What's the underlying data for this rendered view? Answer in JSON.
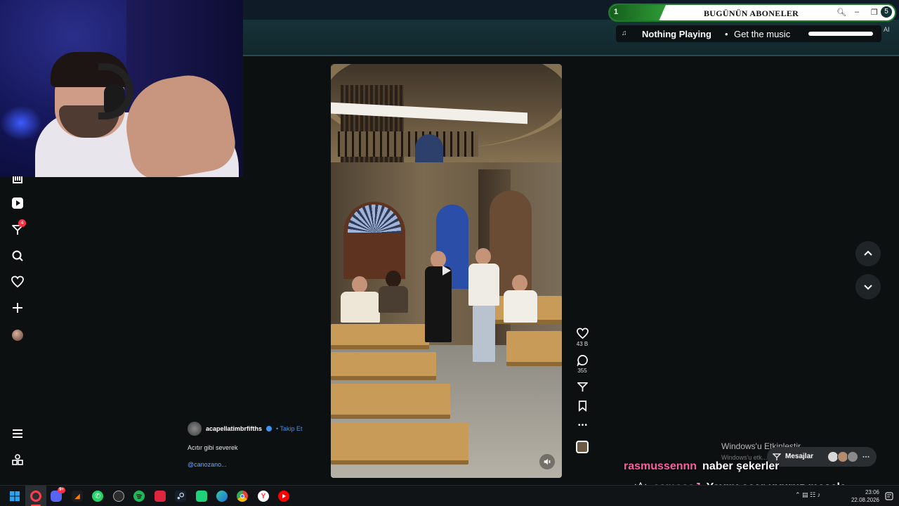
{
  "subscriber_bar": {
    "count": "1",
    "title": "BUGÜNÜN ABONELER",
    "corner_number": "5",
    "icons": [
      "search-icon",
      "minimize-icon",
      "restore-icon"
    ]
  },
  "now_playing": {
    "icon": "music-note-icon",
    "title": "Nothing Playing",
    "separator": "•",
    "subtitle": "Get the music",
    "ai_label": "AI"
  },
  "sidebar": {
    "items": [
      {
        "name": "threads-icon"
      },
      {
        "name": "reels-icon"
      },
      {
        "name": "messages-icon",
        "badge": "4"
      },
      {
        "name": "search-icon"
      },
      {
        "name": "notifications-icon"
      },
      {
        "name": "create-icon"
      },
      {
        "name": "profile-avatar"
      }
    ],
    "bottom": [
      {
        "name": "menu-icon"
      },
      {
        "name": "also-from-meta-icon"
      }
    ]
  },
  "post": {
    "username": "acapellatimbrfifths",
    "follow_label": "Takip Et",
    "caption": "Acıtır gibi severek",
    "mention": "@canozano...",
    "likes": "43 B",
    "comments": "355"
  },
  "windows_activation": {
    "title": "Windows'u Etkinleştir",
    "subtitle": "Windows'u etk..."
  },
  "messages_popup": {
    "label": "Mesajlar"
  },
  "chat": [
    {
      "user": "rasmussennn",
      "message": "naber şekerler"
    },
    {
      "user": "esmaaaJ",
      "message": "Yayını açar uyuruz mesela"
    }
  ],
  "taskbar": {
    "apps": [
      "windows-start-icon",
      "opera-gx-icon",
      "discord-icon",
      "orange-app-icon",
      "whatsapp-icon",
      "app-icon",
      "spotify-icon",
      "red-app-icon",
      "steam-icon",
      "green-app-icon",
      "edge-icon",
      "chrome-icon",
      "yandex-icon",
      "youtube-icon"
    ],
    "discord_badge": "9+",
    "time": "23:06",
    "date": "22.08.2026"
  },
  "colors": {
    "accent_green": "#2f9b36",
    "chat_user": "#ff5fa0",
    "link_blue": "#4a90e2",
    "notif_red": "#ff3040"
  }
}
